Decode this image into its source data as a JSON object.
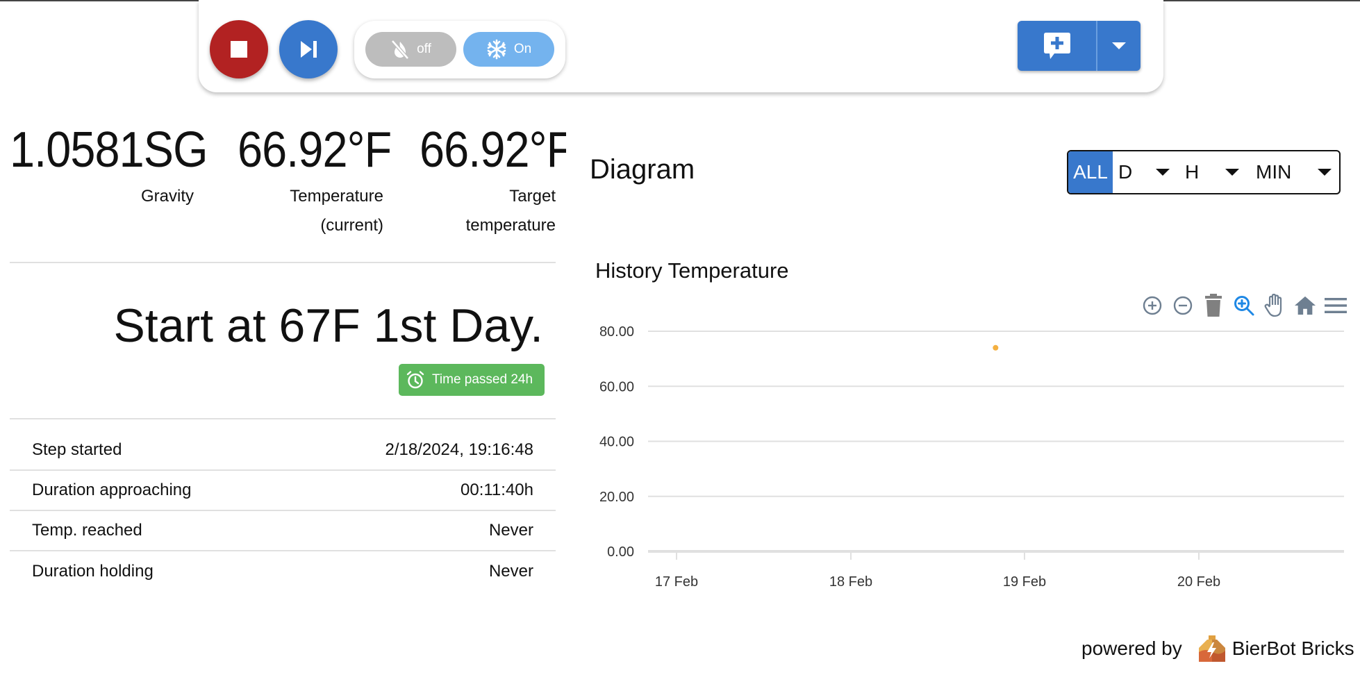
{
  "toolbar": {
    "stop_button": "stop-icon",
    "skip_button": "skip-next-icon",
    "heater_toggle": {
      "icon": "fire-off-icon",
      "label": "off",
      "state": "off"
    },
    "cooler_toggle": {
      "icon": "snowflake-icon",
      "label": "On",
      "state": "on"
    },
    "comment_button": "add-comment-icon",
    "colors": {
      "stop": "#b22222",
      "primary": "#3878cc",
      "toggle_off": "#bdbdbd",
      "toggle_on": "#74b3ee"
    }
  },
  "metrics": [
    {
      "value": "1.0581SG",
      "label_lines": [
        "Gravity"
      ]
    },
    {
      "value": "66.92°F",
      "label_lines": [
        "Temperature",
        "(current)"
      ]
    },
    {
      "value": "66.92°F",
      "label_lines": [
        "Target",
        "temperature"
      ]
    }
  ],
  "step": {
    "title": "Start at 67F 1st Day.",
    "badge": {
      "icon": "alarm-clock-icon",
      "text": "Time passed 24h",
      "color": "#5cb85c"
    }
  },
  "info_table": [
    {
      "label": "Step started",
      "value": "2/18/2024, 19:16:48"
    },
    {
      "label": "Duration approaching",
      "value": "00:11:40h"
    },
    {
      "label": "Temp. reached",
      "value": "Never"
    },
    {
      "label": "Duration holding",
      "value": "Never"
    }
  ],
  "diagram": {
    "title": "Diagram",
    "range_selector": {
      "all_label": "ALL",
      "active": "ALL",
      "dropdowns": [
        {
          "label": "D"
        },
        {
          "label": "H"
        },
        {
          "label": "MIN"
        }
      ]
    },
    "chart_tools": [
      "zoom-in-icon",
      "zoom-out-icon",
      "trash-icon",
      "selection-zoom-icon",
      "pan-hand-icon",
      "reset-home-icon",
      "menu-icon"
    ],
    "active_tool": "selection-zoom-icon"
  },
  "chart_data": {
    "type": "scatter",
    "title": "History Temperature",
    "xlabel": "",
    "ylabel": "",
    "x_ticks": [
      "17 Feb",
      "18 Feb",
      "19 Feb",
      "20 Feb"
    ],
    "x_range_days": [
      16.96,
      20.77
    ],
    "y_ticks": [
      "0.00",
      "20.00",
      "40.00",
      "60.00",
      "80.00"
    ],
    "ylim": [
      0,
      80
    ],
    "grid": true,
    "series": [
      {
        "name": "Temperature",
        "color": "#f4b040",
        "points": [
          {
            "x": "18 Feb ~19:50",
            "x_day": 18.83,
            "y": 74
          }
        ]
      }
    ]
  },
  "footer": {
    "prefix": "powered by",
    "brand": "BierBot Bricks"
  }
}
